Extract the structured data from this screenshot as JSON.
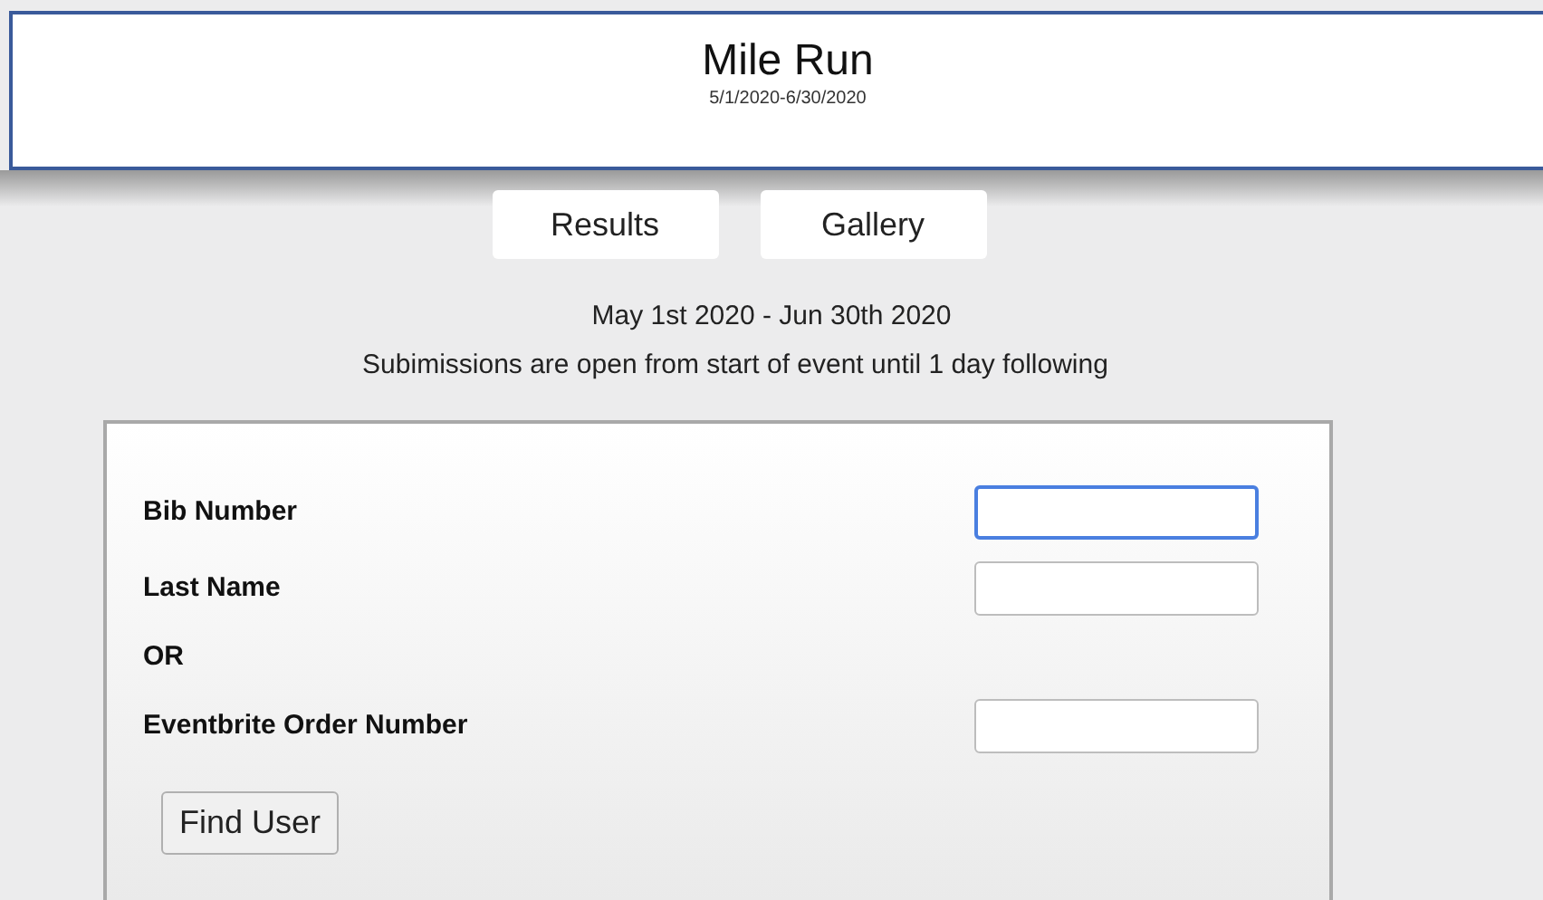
{
  "header": {
    "title": "Mile Run",
    "dates": "5/1/2020-6/30/2020"
  },
  "tabs": [
    {
      "label": "Results",
      "selected": false
    },
    {
      "label": "Gallery",
      "selected": false
    }
  ],
  "date_range": "May 1st 2020 - Jun 30th 2020",
  "notice": "Subimissions are open from start of event until 1 day following",
  "form": {
    "rows": [
      {
        "kind": "field",
        "label": "Bib Number",
        "focused": true
      },
      {
        "kind": "field",
        "label": "Last Name",
        "focused": false
      },
      {
        "kind": "separator",
        "label": "OR"
      },
      {
        "kind": "field",
        "label": "Eventbrite Order Number",
        "focused": false
      }
    ],
    "button": "Find User"
  }
}
